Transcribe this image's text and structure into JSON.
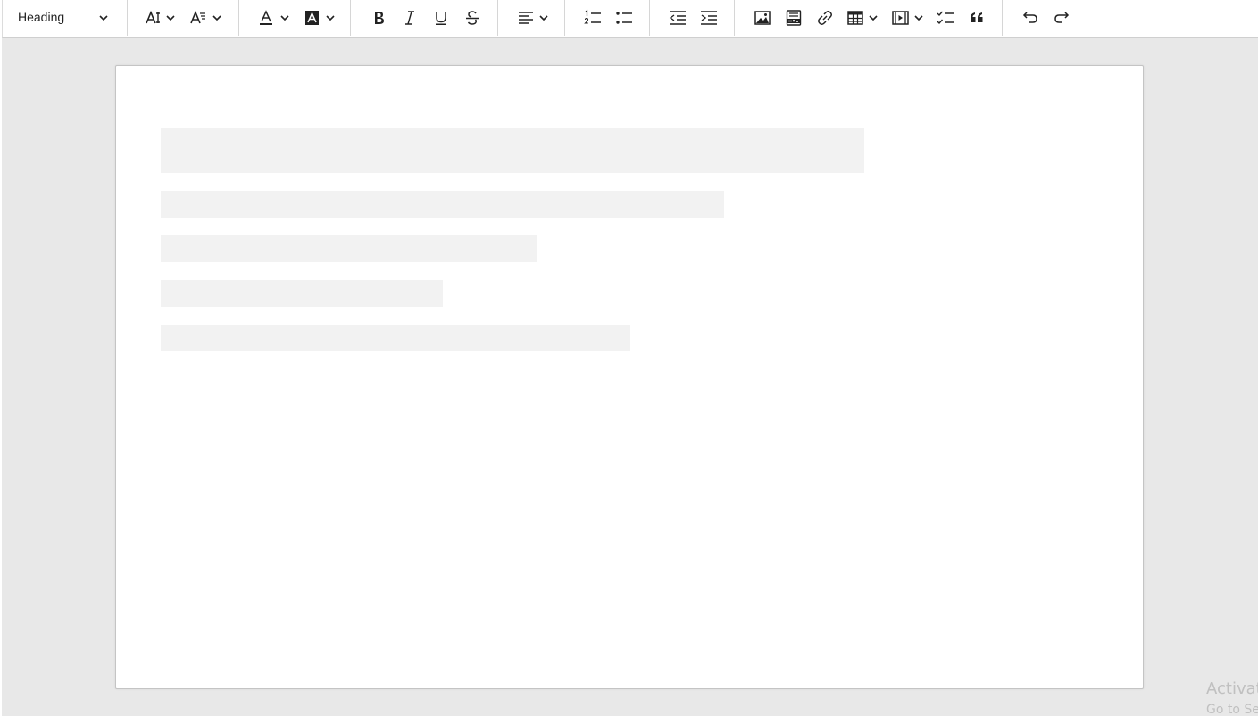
{
  "toolbar": {
    "heading_select": {
      "value": "Heading"
    },
    "groups": [
      [
        "font-size",
        "font-family"
      ],
      [
        "font-color",
        "font-background-color"
      ],
      [
        "bold",
        "italic",
        "underline",
        "strikethrough"
      ],
      [
        "alignment"
      ],
      [
        "numbered-list",
        "bulleted-list"
      ],
      [
        "outdent",
        "indent"
      ],
      [
        "insert-image",
        "html-embed",
        "link",
        "insert-table",
        "insert-media",
        "todo-list",
        "block-quote"
      ],
      [
        "undo",
        "redo"
      ]
    ]
  },
  "editor": {
    "state": "loading-placeholder",
    "skeleton_line_count": 5
  },
  "watermark": {
    "line1": "Activat",
    "line2": "Go to Se"
  },
  "colors": {
    "background": "#e8e8e8",
    "toolbar": "#ffffff",
    "page": "#ffffff",
    "skeleton": "#f2f2f2",
    "icon": "#222222",
    "watermark": "#c0c0c0"
  }
}
